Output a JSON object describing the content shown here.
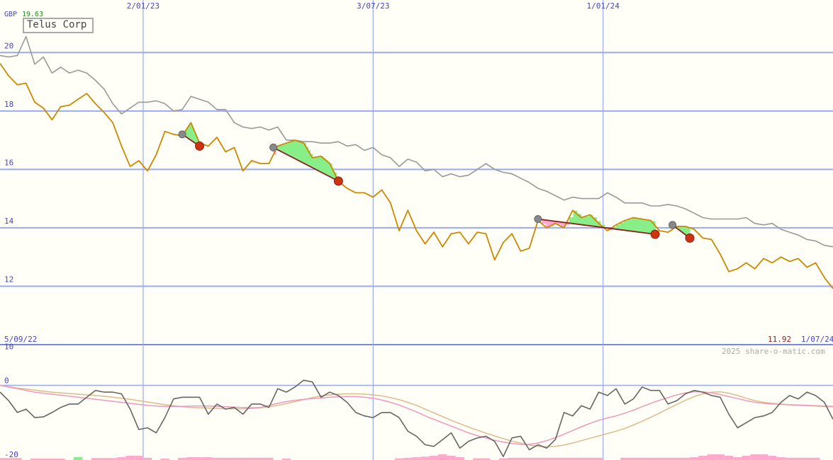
{
  "chart_data": [
    {
      "type": "line",
      "title": "Telus Corp",
      "currency": "GBP",
      "high_value": "19.63",
      "last_value": "11.92",
      "start_date": "5/09/22",
      "end_date": "1/07/24",
      "date_labels": [
        "2/01/23",
        "3/07/23",
        "1/01/24"
      ],
      "y_ticks": [
        20,
        18,
        16,
        14,
        12
      ],
      "ylim": [
        10,
        21.8
      ],
      "x_range": [
        0,
        96
      ],
      "date_label_x": [
        16.5,
        43,
        69.5
      ],
      "grid": true,
      "colors": {
        "price": "#cc8800",
        "reference": "#999999",
        "pattern": "#882222",
        "fall": "#ffaacc",
        "rise": "#88ee88"
      },
      "series": [
        {
          "values": [
            19.63,
            19.2,
            18.9,
            18.95,
            18.3,
            18.1,
            17.7,
            18.15,
            18.2,
            18.4,
            18.6,
            18.25,
            17.95,
            17.6,
            16.8,
            16.1,
            16.3,
            15.95,
            16.5,
            17.3,
            17.2,
            17.15,
            17.6,
            16.9,
            16.8,
            17.1,
            16.6,
            16.75,
            15.95,
            16.3,
            16.2,
            16.2,
            16.8,
            16.9,
            17.0,
            16.9,
            16.4,
            16.45,
            16.2,
            15.6,
            15.35,
            15.2,
            15.2,
            15.05,
            15.3,
            14.85,
            13.9,
            14.6,
            13.9,
            13.45,
            13.85,
            13.35,
            13.8,
            13.85,
            13.45,
            13.85,
            13.8,
            12.9,
            13.5,
            13.8,
            13.2,
            13.3,
            14.25,
            14.0,
            14.15,
            14.0,
            14.6,
            14.35,
            14.45,
            14.15,
            13.9,
            14.1,
            14.25,
            14.35,
            14.3,
            14.25,
            13.9,
            13.85,
            14.05,
            14.05,
            13.95,
            13.65,
            13.6,
            13.1,
            12.5,
            12.6,
            12.8,
            12.6,
            12.95,
            12.8,
            13.0,
            12.85,
            12.95,
            12.65,
            12.8,
            12.3,
            11.92
          ]
        },
        {
          "values": [
            19.9,
            19.85,
            19.9,
            20.55,
            19.6,
            19.85,
            19.3,
            19.5,
            19.3,
            19.4,
            19.3,
            19.05,
            18.75,
            18.25,
            17.9,
            18.1,
            18.3,
            18.3,
            18.35,
            18.25,
            18.0,
            18.05,
            18.5,
            18.4,
            18.3,
            18.05,
            18.05,
            17.6,
            17.45,
            17.4,
            17.45,
            17.35,
            17.45,
            17.0,
            17.0,
            16.95,
            16.95,
            16.9,
            16.9,
            16.95,
            16.8,
            16.85,
            16.65,
            16.75,
            16.5,
            16.4,
            16.1,
            16.35,
            16.25,
            15.95,
            16.0,
            15.75,
            15.85,
            15.75,
            15.8,
            16.0,
            16.2,
            16.0,
            15.9,
            15.85,
            15.7,
            15.55,
            15.35,
            15.25,
            15.1,
            14.95,
            15.05,
            15.0,
            15.0,
            15.0,
            15.2,
            15.05,
            14.85,
            14.85,
            14.85,
            14.75,
            14.75,
            14.8,
            14.75,
            14.65,
            14.5,
            14.35,
            14.3,
            14.3,
            14.3,
            14.3,
            14.35,
            14.15,
            14.1,
            14.15,
            13.95,
            13.85,
            13.75,
            13.6,
            13.55,
            13.4,
            13.35
          ]
        }
      ],
      "patterns": [
        {
          "from": [
            21,
            17.2
          ],
          "to": [
            23,
            16.8
          ]
        },
        {
          "from": [
            31.5,
            16.75
          ],
          "to": [
            39,
            15.6
          ]
        },
        {
          "from": [
            62,
            14.3
          ],
          "to": [
            75.5,
            13.78
          ]
        },
        {
          "from": [
            77.5,
            14.1
          ],
          "to": [
            79.5,
            13.65
          ]
        }
      ]
    },
    {
      "type": "line",
      "y_ticks": [
        10,
        0,
        -20
      ],
      "ylim": [
        -22,
        12
      ],
      "series": [
        {
          "values": [
            -2,
            -4.5,
            -8,
            -7,
            -9.5,
            -9.3,
            -8,
            -6.5,
            -5.5,
            -5.5,
            -3.5,
            -1.5,
            -2,
            -2,
            -2.5,
            -7,
            -13,
            -12.5,
            -14,
            -9.5,
            -4,
            -3.5,
            -3.5,
            -3.5,
            -8.5,
            -5.5,
            -7,
            -6.5,
            -8.5,
            -5.5,
            -5.5,
            -6.5,
            -1,
            -2,
            -0.5,
            1.5,
            1,
            -3.5,
            -2,
            -3,
            -5,
            -8,
            -9,
            -9.5,
            -8,
            -8,
            -9.5,
            -13.5,
            -15,
            -17.5,
            -18,
            -16,
            -14,
            -18.5,
            -16.5,
            -15.5,
            -15,
            -16.5,
            -21,
            -15.5,
            -15,
            -19,
            -17.5,
            -18.5,
            -16,
            -8,
            -9,
            -6,
            -7,
            -2,
            -3,
            -1,
            -5.5,
            -4,
            -0.5,
            -1.5,
            -1.5,
            -5.5,
            -4.5,
            -2.5,
            -1.5,
            -2,
            -3,
            -3.5,
            -8.5,
            -12.5,
            -11,
            -9.5,
            -9,
            -8,
            -5,
            -3,
            -4,
            -2,
            -3,
            -5,
            -10
          ]
        },
        {
          "values": [
            0,
            -0.5,
            -1,
            -1.5,
            -2,
            -2.3,
            -2.6,
            -2.9,
            -3.2,
            -3.5,
            -3.8,
            -4.1,
            -4.4,
            -4.7,
            -5,
            -5.3,
            -5.6,
            -5.9,
            -6.1,
            -6.2,
            -6.2,
            -6.2,
            -6.1,
            -6.1,
            -6.1,
            -6.2,
            -6.3,
            -6.4,
            -6.5,
            -6.6,
            -6.5,
            -5.9,
            -5.3,
            -4.8,
            -4.4,
            -4.1,
            -3.9,
            -3.7,
            -3.5,
            -3.4,
            -3.3,
            -3.3,
            -3.5,
            -3.8,
            -4.3,
            -5,
            -5.8,
            -6.8,
            -7.8,
            -9,
            -10,
            -11,
            -12,
            -13,
            -14,
            -14.8,
            -15.5,
            -16.2,
            -16.7,
            -17.1,
            -17.4,
            -17.4,
            -17,
            -16.3,
            -15.4,
            -14.4,
            -13.3,
            -12.2,
            -11.2,
            -10.3,
            -9.6,
            -9,
            -8.2,
            -7.3,
            -6.3,
            -5.3,
            -4.4,
            -3.6,
            -2.8,
            -2.2,
            -1.9,
            -1.9,
            -2.2,
            -2.7,
            -3.3,
            -3.9,
            -4.5,
            -5,
            -5.3,
            -5.5,
            -5.6,
            -5.7,
            -5.8,
            -5.9,
            -6,
            -6.1,
            -6.2
          ]
        },
        {
          "values": [
            0,
            -0.4,
            -0.8,
            -1.1,
            -1.4,
            -1.7,
            -2,
            -2.2,
            -2.4,
            -2.6,
            -2.8,
            -3,
            -3.2,
            -3.5,
            -3.8,
            -4.1,
            -4.5,
            -4.9,
            -5.3,
            -5.7,
            -6,
            -6.3,
            -6.5,
            -6.6,
            -6.7,
            -6.8,
            -6.9,
            -6.9,
            -6.9,
            -6.8,
            -6.6,
            -6.3,
            -5.9,
            -5.4,
            -4.8,
            -4.2,
            -3.6,
            -3.1,
            -2.8,
            -2.6,
            -2.5,
            -2.5,
            -2.6,
            -2.8,
            -3.1,
            -3.6,
            -4.2,
            -5,
            -5.9,
            -7,
            -8.1,
            -9.2,
            -10.3,
            -11.3,
            -12.3,
            -13.2,
            -14.1,
            -14.9,
            -15.7,
            -16.4,
            -17,
            -17.6,
            -18,
            -18.1,
            -18,
            -17.6,
            -17,
            -16.3,
            -15.6,
            -14.9,
            -14.2,
            -13.5,
            -12.7,
            -11.7,
            -10.6,
            -9.4,
            -8.2,
            -6.9,
            -5.6,
            -4.4,
            -3.3,
            -2.5,
            -2,
            -1.9,
            -2.3,
            -3,
            -3.8,
            -4.5,
            -5,
            -5.3,
            -5.5,
            -5.7,
            -5.9,
            -6,
            -6.1,
            -6.2,
            -6.3
          ]
        }
      ],
      "colors": {
        "momentum": "#666666",
        "average_fast": "#ee99bb",
        "average_slow": "#ddbb88"
      }
    },
    {
      "type": "bar",
      "colors": {
        "fall": "#ffaacc",
        "rise": "#88ee88"
      },
      "values": [
        -0.7,
        -0.7,
        -0.7,
        0,
        -0.5,
        -0.5,
        -0.5,
        -0.5,
        0,
        -0.7,
        0,
        -0.7,
        -0.7,
        -0.7,
        -1,
        -1.5,
        -1.5,
        -0.8,
        0,
        -0.5,
        0,
        -0.8,
        -1,
        -1,
        -1,
        -0.8,
        -0.8,
        -0.8,
        -0.8,
        -0.8,
        -0.8,
        -0.8,
        0,
        -0.5,
        0,
        0,
        0,
        0,
        0,
        0,
        0,
        0,
        0,
        0,
        0,
        0,
        -0.6,
        -0.8,
        -1,
        -1.2,
        -1.5,
        -2,
        -1.5,
        -1,
        0,
        -0.6,
        -0.6,
        0,
        -0.6,
        -0.8,
        -0.8,
        -0.8,
        -0.8,
        -0.8,
        -0.8,
        -0.8,
        -0.8,
        -0.8,
        -0.8,
        -0.8,
        0,
        0,
        -0.8,
        -0.8,
        -0.8,
        -0.8,
        -0.8,
        -0.8,
        -0.8,
        -0.8,
        -1,
        -1.5,
        -2,
        -2,
        -1.5,
        -1,
        -1.5,
        -2,
        -2,
        -1.5,
        -1,
        -0.8,
        -0.8,
        -0.8,
        -0.8,
        0,
        0
      ],
      "rise_values": [
        0,
        0,
        0,
        0,
        0,
        0,
        0,
        0,
        0,
        1,
        0,
        0,
        0,
        0,
        0,
        0,
        0,
        0,
        0,
        0,
        0,
        0,
        0,
        0,
        0,
        0,
        0,
        0,
        0,
        0,
        0,
        0,
        0,
        0,
        0,
        0,
        0,
        0,
        0,
        0,
        0,
        0,
        0,
        0,
        0,
        0,
        0,
        0,
        0,
        0,
        0,
        0,
        0,
        0,
        0,
        0,
        0,
        0,
        0,
        0,
        0,
        0,
        0,
        0,
        0,
        0,
        0,
        0,
        0,
        0,
        0,
        0,
        0,
        0,
        0,
        0,
        0,
        0,
        0,
        0,
        0,
        0,
        0,
        0,
        0,
        0,
        0,
        0,
        0,
        0,
        0,
        0,
        0,
        0,
        0,
        0,
        0
      ]
    }
  ],
  "footer": {
    "copyright": "2025 share-o-matic.com"
  }
}
